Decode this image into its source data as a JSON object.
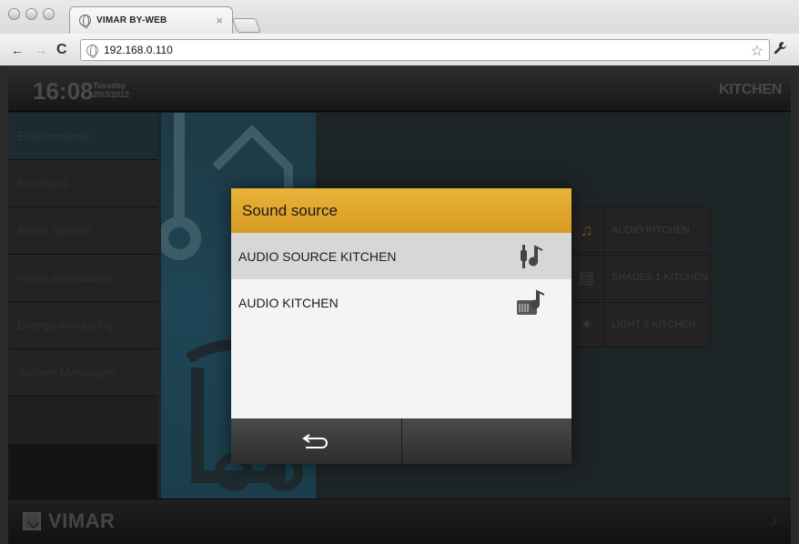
{
  "browser": {
    "tab_title": "VIMAR BY-WEB",
    "tab_close": "×",
    "url": "192.168.0.110",
    "back": "←",
    "forward": "→",
    "reload": "C",
    "star": "☆",
    "wrench": "🔧"
  },
  "header": {
    "time": "16:08",
    "weekday": "Tuesday",
    "date": "20/3/2012",
    "room": "KITCHEN"
  },
  "sidebar": {
    "items": [
      {
        "label": "Environments",
        "active": true
      },
      {
        "label": "Functions"
      },
      {
        "label": "Alarm System"
      },
      {
        "label": "Video surveillance"
      },
      {
        "label": "Energy monitoring"
      },
      {
        "label": "System Messages"
      }
    ]
  },
  "devices": [
    {
      "label": "AUDIO KITCHEN",
      "icon": "audio-icon"
    },
    {
      "label": "SHADES 1 KITCHEN",
      "icon": "shades-icon"
    },
    {
      "label": "LIGHT 2 KITCHEN",
      "icon": "light-icon"
    }
  ],
  "footer": {
    "brand": "VIMAR"
  },
  "modal": {
    "title": "Sound source",
    "rows": [
      {
        "label": "AUDIO SOURCE KITCHEN",
        "icon": "audio-source-icon",
        "selected": true
      },
      {
        "label": "AUDIO KITCHEN",
        "icon": "radio-music-icon",
        "selected": false
      }
    ],
    "back_symbol": "⮌"
  }
}
